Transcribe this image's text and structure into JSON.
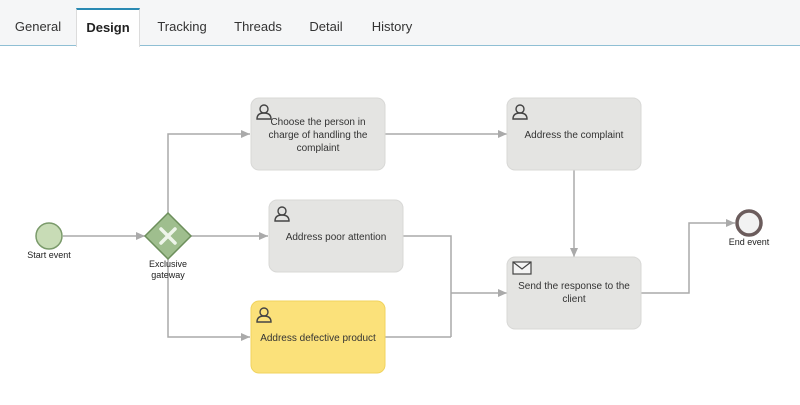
{
  "tabs": [
    {
      "label": "General"
    },
    {
      "label": "Design",
      "active": true
    },
    {
      "label": "Tracking"
    },
    {
      "label": "Threads"
    },
    {
      "label": "Detail"
    },
    {
      "label": "History"
    }
  ],
  "diagram": {
    "start_event_label": "Start event",
    "end_event_label": "End event",
    "gateway_label_line1": "Exclusive",
    "gateway_label_line2": "gateway",
    "tasks": {
      "choose_person": {
        "line1": "Choose the person in",
        "line2": "charge of handling the",
        "line3": "complaint"
      },
      "address_complaint": {
        "line1": "Address the complaint"
      },
      "address_poor_attention": {
        "line1": "Address poor attention"
      },
      "address_defective": {
        "line1": "Address defective product"
      },
      "send_response": {
        "line1": "Send the response to the",
        "line2": "client"
      }
    }
  },
  "colors": {
    "task_fill": "#e4e4e2",
    "task_highlight": "#fbe17a",
    "gateway_fill": "#9fbe8e",
    "gateway_stroke": "#6d8f5c",
    "start_fill": "#c8dcb6",
    "start_stroke": "#7a9a6a",
    "end_stroke": "#6b5c5c",
    "connector": "#aaaaaa",
    "accent": "#2a8ab3"
  }
}
